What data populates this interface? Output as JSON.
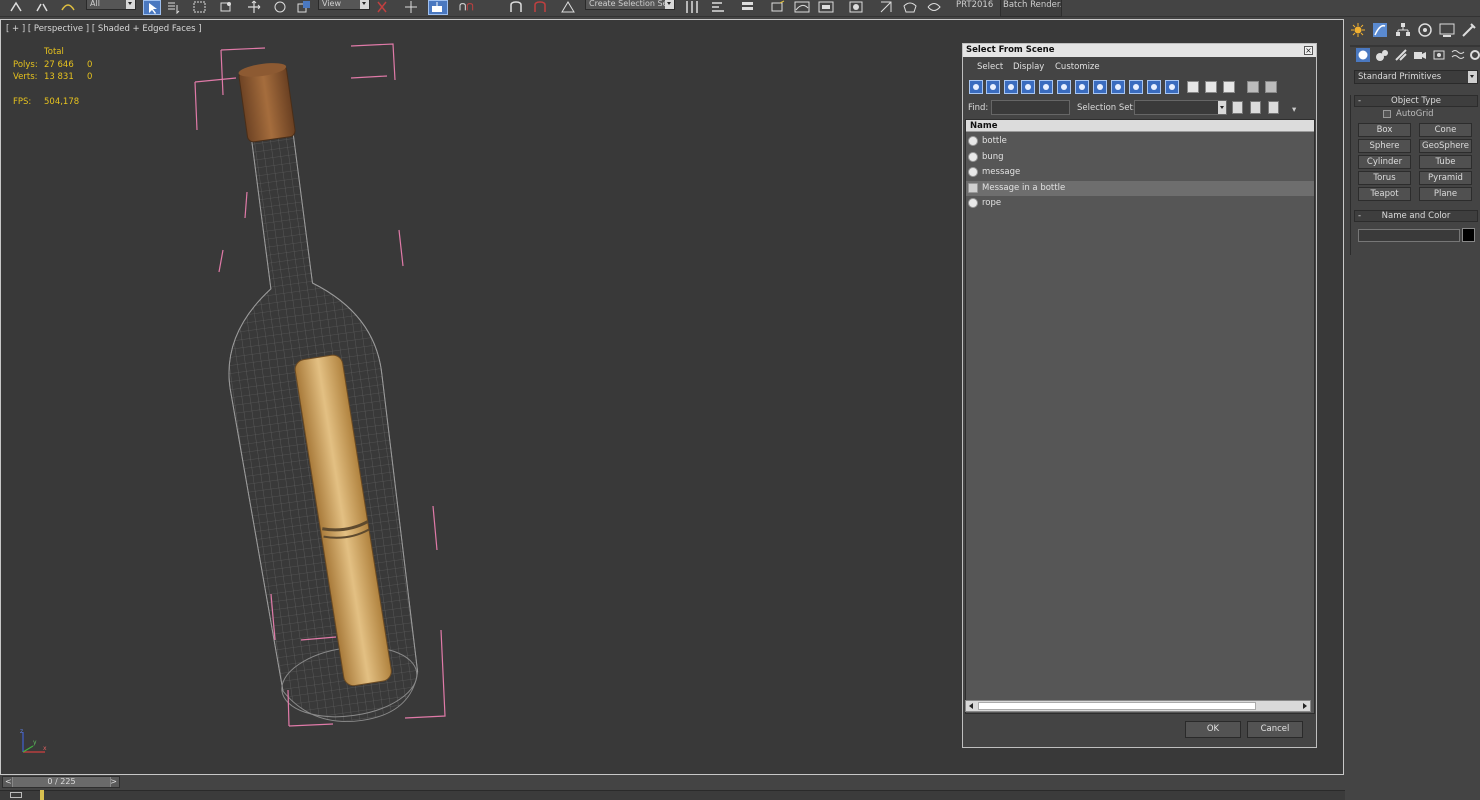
{
  "toolbar": {
    "filter_selected": "All",
    "ref_coord": "View",
    "selection_set_placeholder": "Create Selection Se",
    "prt_label": "PRT2016",
    "batch_render_label": "Batch Render.."
  },
  "viewport": {
    "label": "[ + ] [ Perspective ] [ Shaded + Edged Faces ]",
    "stats": {
      "total_header": "Total",
      "polys_label": "Polys:",
      "polys_total": "27 646",
      "polys_sel": "0",
      "verts_label": "Verts:",
      "verts_total": "13 831",
      "verts_sel": "0",
      "fps_label": "FPS:",
      "fps_value": "504,178"
    },
    "gizmo": {
      "x": "x",
      "y": "y",
      "z": "z"
    }
  },
  "dialog": {
    "title": "Select From Scene",
    "close_glyph": "×",
    "menu": [
      "Select",
      "Display",
      "Customize"
    ],
    "find_label": "Find:",
    "find_value": "",
    "selection_set_label": "Selection Set:",
    "column_header": "Name",
    "items": [
      {
        "name": "bottle",
        "type": "object",
        "selected": false
      },
      {
        "name": "bung",
        "type": "object",
        "selected": false
      },
      {
        "name": "message",
        "type": "object",
        "selected": false
      },
      {
        "name": "Message in a bottle",
        "type": "group",
        "selected": true
      },
      {
        "name": "rope",
        "type": "object",
        "selected": false
      }
    ],
    "ok_label": "OK",
    "cancel_label": "Cancel"
  },
  "command_panel": {
    "category_dropdown": "Standard Primitives",
    "object_type_title": "Object Type",
    "autogrid_label": "AutoGrid",
    "primitives": [
      "Box",
      "Cone",
      "Sphere",
      "GeoSphere",
      "Cylinder",
      "Tube",
      "Torus",
      "Pyramid",
      "Teapot",
      "Plane"
    ],
    "name_color_title": "Name and Color",
    "name_value": "",
    "object_color": "#000000"
  },
  "timeline": {
    "frame_display": "0 / 225",
    "prev_glyph": "<",
    "next_glyph": ">"
  },
  "colors": {
    "viewport_bg": "#393939",
    "stats_text": "#e6c21e",
    "bbox_brackets": "#e07aa8",
    "selection_highlight": "#4a78c0"
  }
}
